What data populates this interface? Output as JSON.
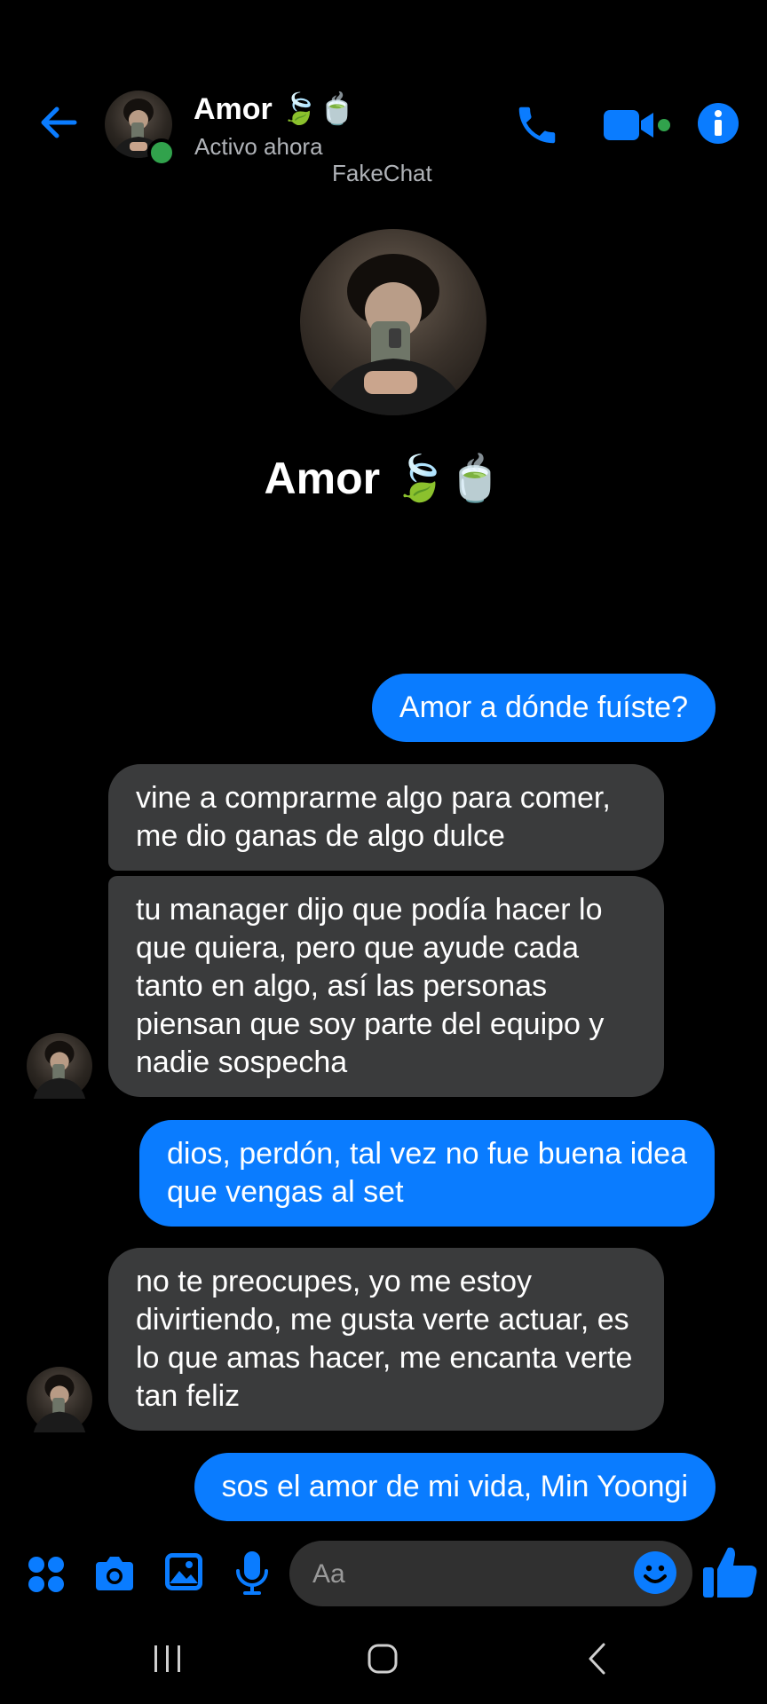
{
  "header": {
    "contact_name": "Amor 🍃🍵",
    "status": "Activo ahora",
    "watermark": "FakeChat",
    "online": true
  },
  "profile": {
    "name": "Amor 🍃🍵"
  },
  "messages": [
    {
      "direction": "out",
      "text": "Amor a dónde fuíste?"
    },
    {
      "direction": "in",
      "text": "vine a comprarme algo para comer, me dio ganas de algo dulce"
    },
    {
      "direction": "in",
      "text": "tu manager dijo que podía hacer lo que quiera, pero que ayude cada tanto en algo, así las personas piensan que soy parte del equipo y nadie sospecha"
    },
    {
      "direction": "out",
      "text": "dios, perdón, tal vez no fue buena idea que vengas al set"
    },
    {
      "direction": "in",
      "text": "no te preocupes, yo me estoy divirtiendo, me gusta verte actuar, es lo que amas hacer, me encanta verte tan feliz"
    },
    {
      "direction": "out",
      "text": "sos el amor de mi vida, Min Yoongi"
    }
  ],
  "composer": {
    "placeholder": "Aa"
  },
  "icons": {
    "back": "arrow-left-icon",
    "call": "phone-icon",
    "video": "video-camera-icon",
    "info": "info-icon",
    "apps": "apps-grid-icon",
    "camera": "camera-icon",
    "gallery": "image-icon",
    "voice": "microphone-icon",
    "emoji": "emoji-icon",
    "like": "thumbs-up-icon"
  },
  "colors": {
    "accent": "#0a7cff",
    "incoming_bubble": "#3a3b3c",
    "online": "#31a24c",
    "background": "#000000"
  }
}
